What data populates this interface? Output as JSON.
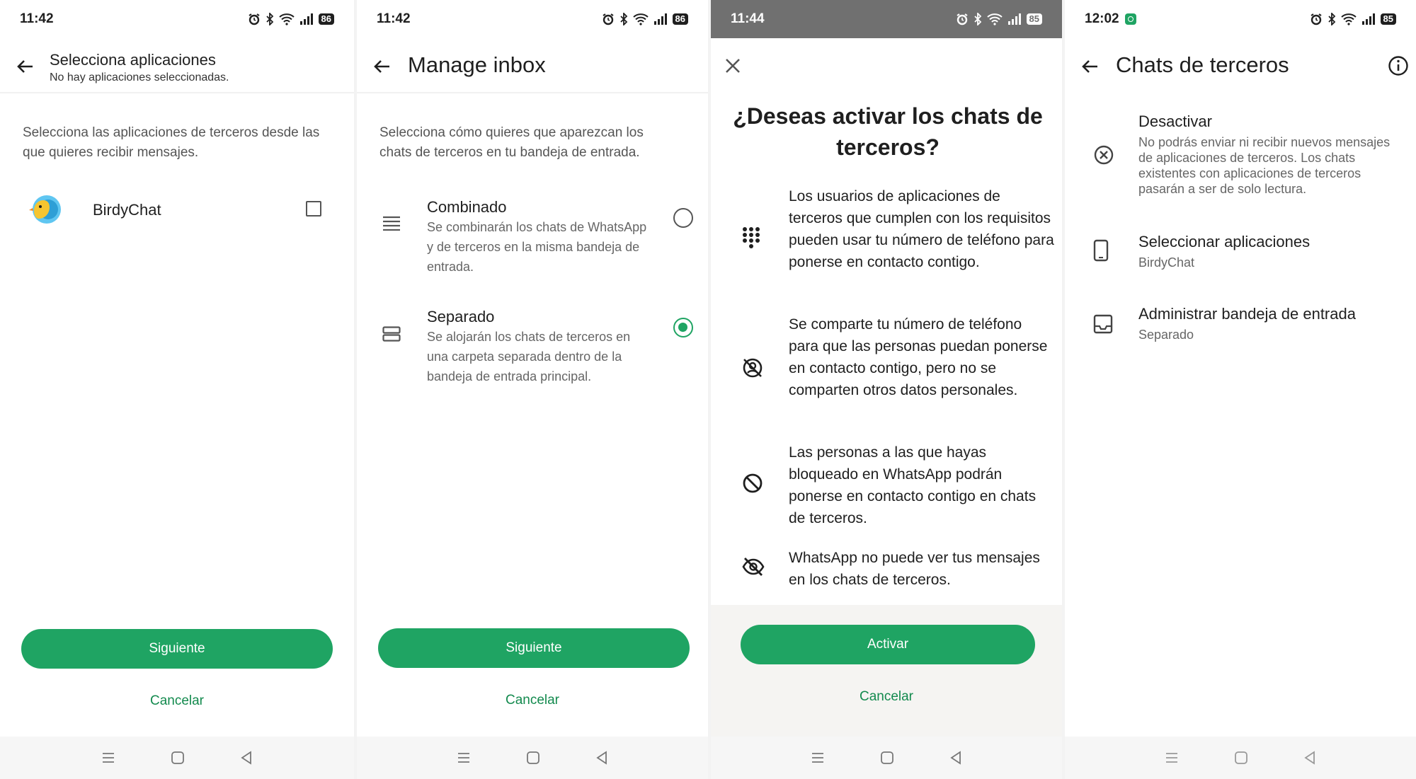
{
  "colors": {
    "accent": "#1fa463",
    "link": "#138a4e"
  },
  "screen1": {
    "status_time": "11:42",
    "battery": "86",
    "title": "Selecciona aplicaciones",
    "subtitle": "No hay aplicaciones seleccionadas.",
    "description": "Selecciona las aplicaciones de terceros desde las que quieres recibir mensajes.",
    "app_name": "BirdyChat",
    "next": "Siguiente",
    "cancel": "Cancelar"
  },
  "screen2": {
    "status_time": "11:42",
    "battery": "86",
    "title": "Manage inbox",
    "description": "Selecciona cómo quieres que aparezcan los chats de terceros en tu bandeja de entrada.",
    "options": [
      {
        "title": "Combinado",
        "desc": "Se combinarán los chats de WhatsApp y de terceros en la misma bandeja de entrada.",
        "selected": false
      },
      {
        "title": "Separado",
        "desc": "Se alojarán los chats de terceros en una carpeta separada dentro de la bandeja de entrada principal.",
        "selected": true
      }
    ],
    "next": "Siguiente",
    "cancel": "Cancelar"
  },
  "screen3": {
    "status_time": "11:44",
    "battery": "85",
    "title": "¿Deseas activar los chats de terceros?",
    "features": [
      {
        "icon": "dialpad-icon",
        "text": "Los usuarios de aplicaciones de terceros que cumplen con los requisitos pueden usar tu número de teléfono para ponerse en contacto contigo."
      },
      {
        "icon": "no-contact-icon",
        "text": "Se comparte tu número de teléfono para que las personas puedan ponerse en contacto contigo, pero no se comparten otros datos personales."
      },
      {
        "icon": "block-icon",
        "text": "Las personas a las que hayas bloqueado en WhatsApp podrán ponerse en contacto contigo en chats de terceros."
      },
      {
        "icon": "eye-off-icon",
        "text": "WhatsApp no puede ver tus mensajes en los chats de terceros."
      }
    ],
    "activate": "Activar",
    "cancel": "Cancelar"
  },
  "screen4": {
    "status_time": "12:02",
    "battery": "85",
    "title": "Chats de terceros",
    "settings": [
      {
        "icon": "cancel-circle-icon",
        "title": "Desactivar",
        "desc": "No podrás enviar ni recibir nuevos mensajes de aplicaciones de terceros. Los chats existentes con aplicaciones de terceros pasarán a ser de solo lectura."
      },
      {
        "icon": "phone-icon",
        "title": "Seleccionar aplicaciones",
        "desc": "BirdyChat"
      },
      {
        "icon": "inbox-icon",
        "title": "Administrar bandeja de entrada",
        "desc": "Separado"
      }
    ]
  }
}
